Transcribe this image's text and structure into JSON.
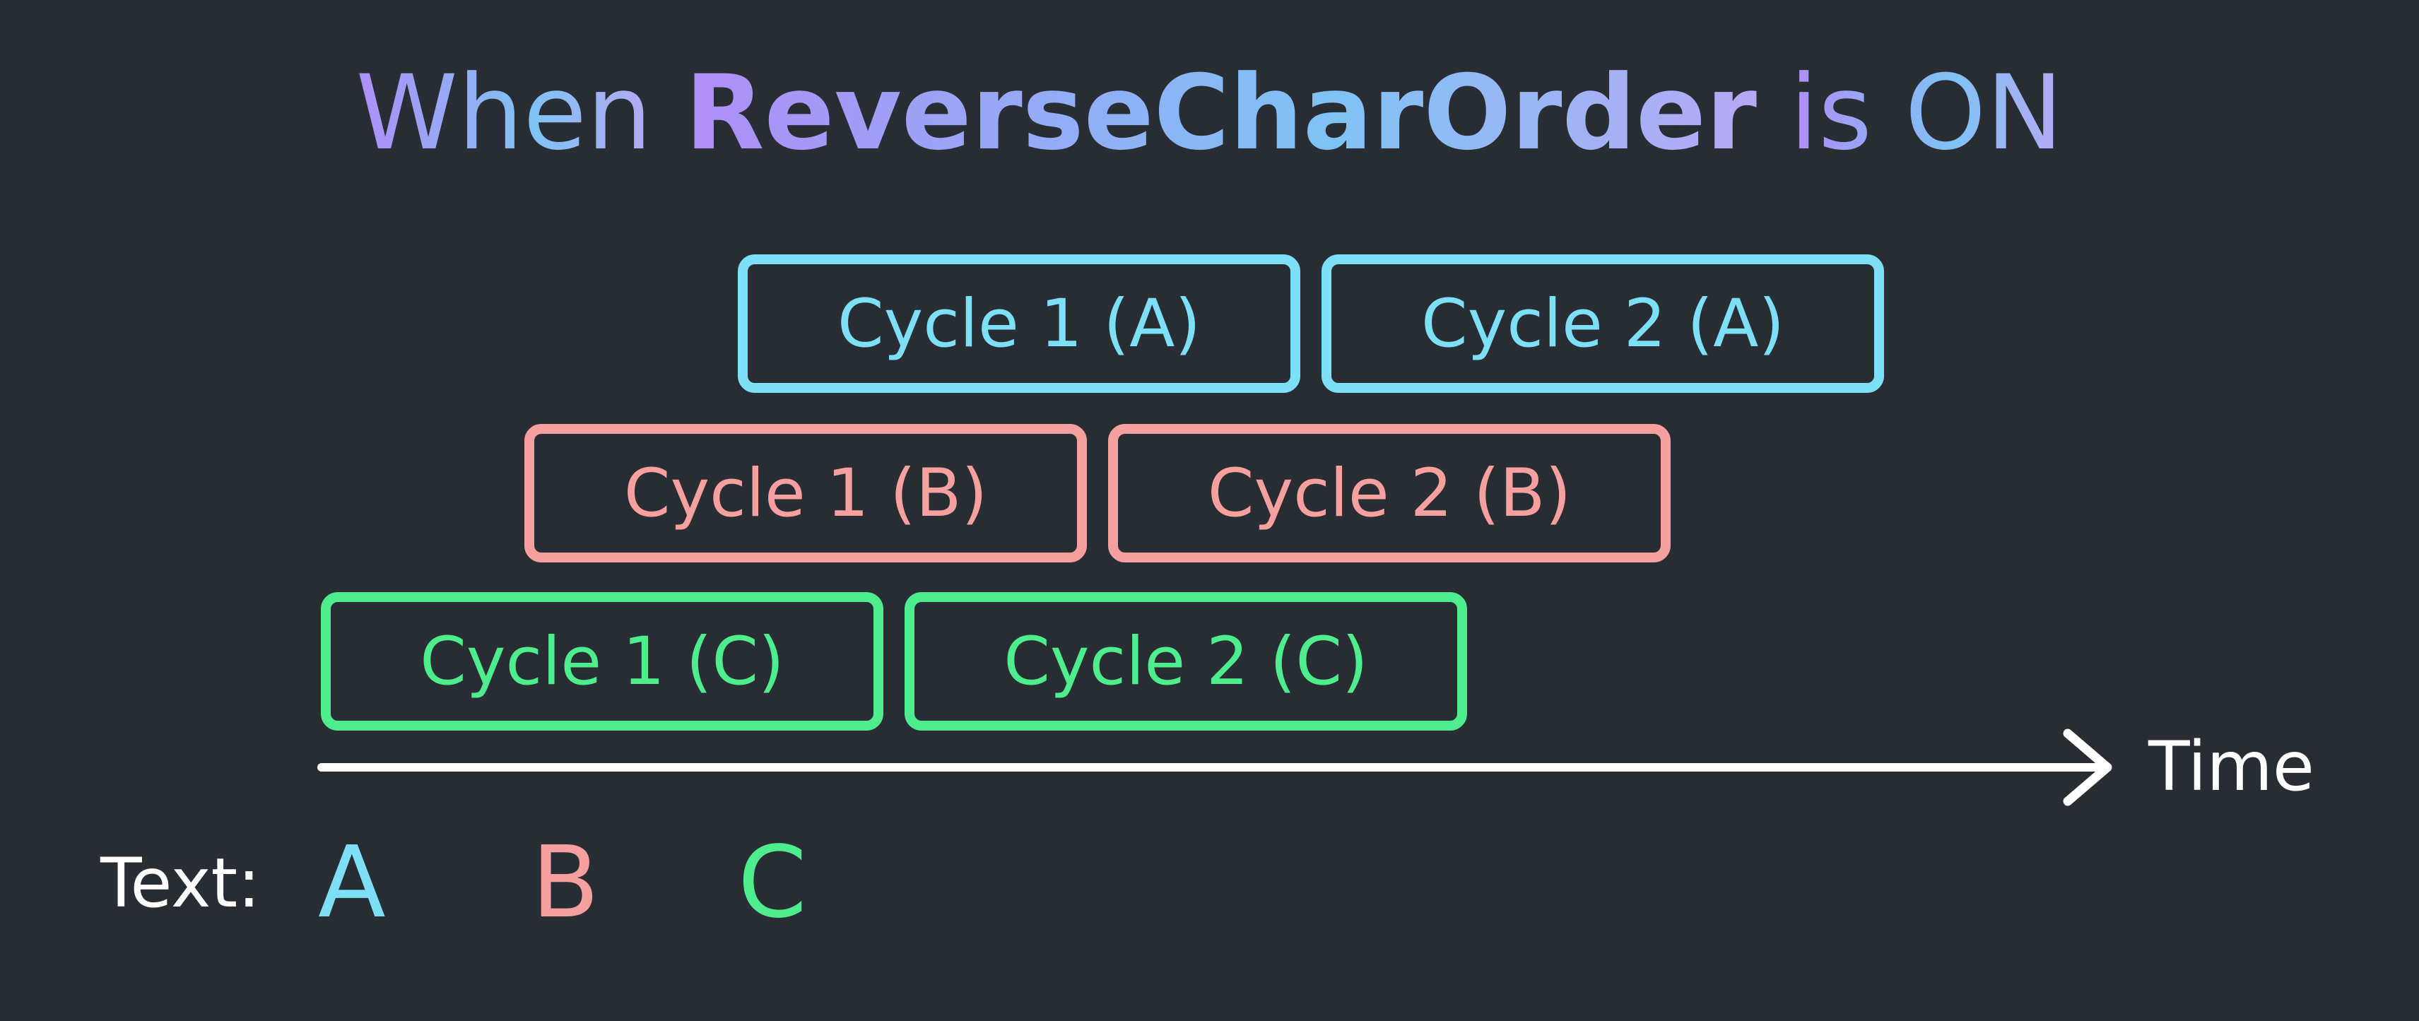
{
  "title": {
    "prefix": "When",
    "highlight": "ReverseCharOrder",
    "suffix": "is ON"
  },
  "colors": {
    "background": "#282c33",
    "a": "#7ee0f6",
    "b": "#f7a0a0",
    "c": "#4eee8e",
    "axis": "#ffffff"
  },
  "rows": {
    "a": {
      "cycle1": "Cycle 1 (A)",
      "cycle2": "Cycle 2 (A)"
    },
    "b": {
      "cycle1": "Cycle 1 (B)",
      "cycle2": "Cycle 2 (B)"
    },
    "c": {
      "cycle1": "Cycle 1 (C)",
      "cycle2": "Cycle 2 (C)"
    }
  },
  "axis": {
    "label": "Time"
  },
  "text": {
    "label": "Text:",
    "chars": [
      "A",
      "B",
      "C"
    ]
  }
}
